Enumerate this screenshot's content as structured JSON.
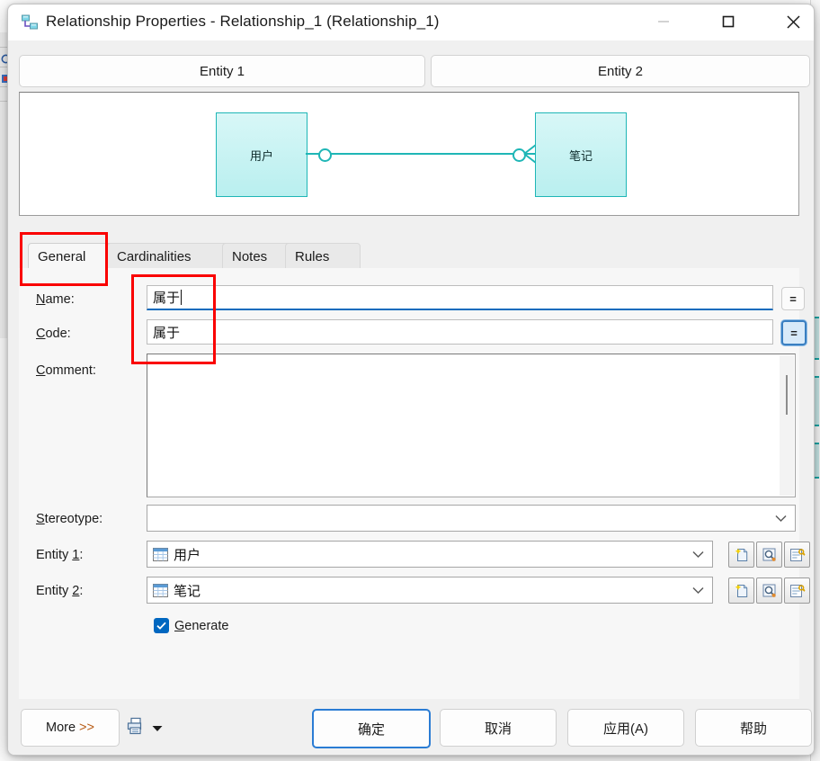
{
  "window": {
    "title": "Relationship Properties - Relationship_1 (Relationship_1)",
    "icon": "relationship-icon",
    "controls": {
      "minimize": "minimize-icon",
      "maximize": "maximize-icon",
      "close": "close-icon"
    }
  },
  "entity_tabs": [
    {
      "label": "Entity 1"
    },
    {
      "label": "Entity 2"
    }
  ],
  "diagram": {
    "entity_left": "用户",
    "entity_right": "笔记",
    "left_cardinality_symbol": "circle",
    "right_cardinality_symbol": "circle-crowsfoot",
    "entity_fill": "#c5f2f2",
    "entity_border": "#1fb6b6",
    "line_color": "#1fb6b6"
  },
  "property_tabs": [
    {
      "label": "General",
      "active": true
    },
    {
      "label": "Cardinalities",
      "active": false
    },
    {
      "label": "Notes",
      "active": false
    },
    {
      "label": "Rules",
      "active": false
    }
  ],
  "form": {
    "name": {
      "label_prefix": "",
      "label_accel": "N",
      "label_suffix": "ame:",
      "value": "属于",
      "focused": true
    },
    "code": {
      "label_accel": "C",
      "label_suffix": "ode:",
      "value": "属于",
      "eq_button_focused": true
    },
    "comment": {
      "label_accel": "C",
      "label_suffix": "omment:",
      "value": ""
    },
    "stereotype": {
      "label_accel": "S",
      "label_suffix": "tereotype:",
      "value": ""
    },
    "entity1": {
      "label_prefix": "Entity ",
      "label_accel": "1",
      "label_suffix": ":",
      "value": "用户"
    },
    "entity2": {
      "label_prefix": "Entity ",
      "label_accel": "2",
      "label_suffix": ":",
      "value": "笔记"
    },
    "generate": {
      "label_accel": "G",
      "label_suffix": "enerate",
      "checked": true
    },
    "eq_button_label": "=",
    "row_buttons": [
      "create-icon",
      "browse-icon",
      "properties-icon"
    ]
  },
  "footer": {
    "more": "More",
    "more_arrows": ">>",
    "print_icon": "print-icon",
    "print_dropdown": "chevron-down-icon",
    "ok": "确定",
    "cancel": "取消",
    "apply": "应用(A)",
    "help": "帮助"
  },
  "annotations": {
    "accent_color": "#fa0000",
    "rects": [
      "general-tab-highlight",
      "name-code-value-highlight"
    ]
  }
}
